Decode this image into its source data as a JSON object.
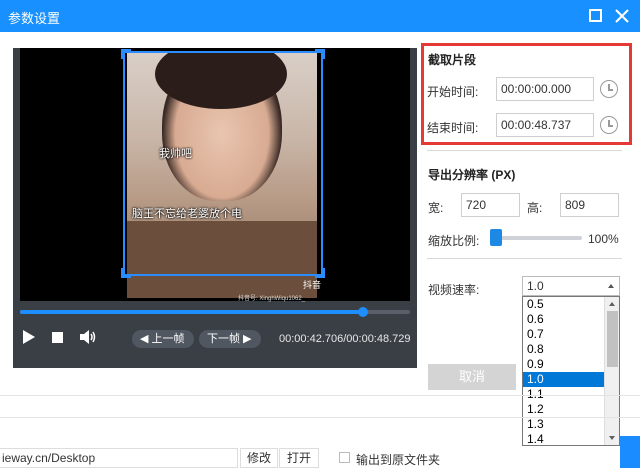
{
  "window": {
    "title": "参数设置"
  },
  "player": {
    "subtitle_line1": "我帅吧",
    "subtitle_line2": "脑王不忘给老婆放个电",
    "watermark_logo": "抖音",
    "watermark_id": "抖音号: XinghWiqu1062_",
    "progress_fraction": 0.879,
    "prev_frame_label": "◀ 上一帧",
    "next_frame_label": "下一帧 ▶",
    "time_display": "00:00:42.706/00:00:48.729"
  },
  "clip": {
    "section_title": "截取片段",
    "start_label": "开始时间:",
    "start_value": "00:00:00.000",
    "end_label": "结束时间:",
    "end_value": "00:00:48.737"
  },
  "resolution": {
    "section_title": "导出分辨率 (PX)",
    "width_label": "宽:",
    "width_value": "720",
    "height_label": "高:",
    "height_value": "809",
    "scale_label": "缩放比例:",
    "scale_value": "100%",
    "scale_fraction": 0.0
  },
  "speed": {
    "label": "视频速率:",
    "selected": "1.0",
    "options": [
      "0.5",
      "0.6",
      "0.7",
      "0.8",
      "0.9",
      "1.0",
      "1.1",
      "1.2",
      "1.3",
      "1.4"
    ],
    "selected_index": 5
  },
  "actions": {
    "cancel_label": "取消"
  },
  "output": {
    "path_value": "ieway.cn/Desktop",
    "edit_label": "修改",
    "open_label": "打开",
    "checkbox_label": "输出到原文件夹",
    "checkbox_checked": false
  },
  "colors": {
    "accent": "#1890ff",
    "highlight_border": "#e53935",
    "dropdown_selected": "#0078d7"
  }
}
